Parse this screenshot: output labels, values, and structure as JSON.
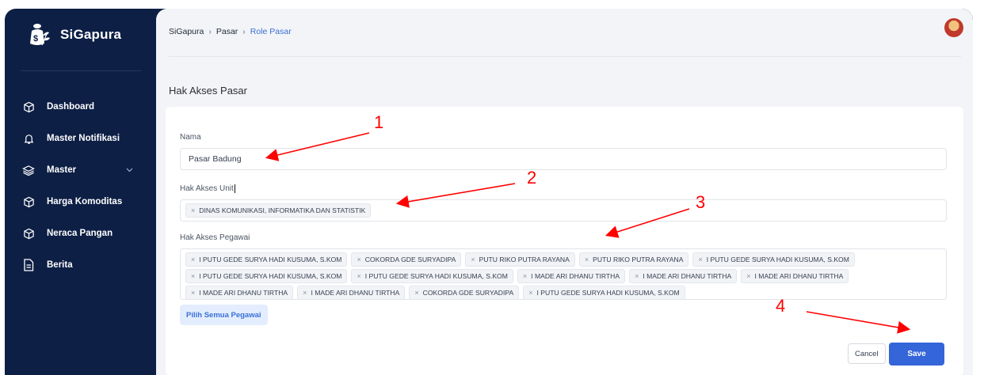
{
  "app": {
    "name": "SiGapura"
  },
  "sidebar": {
    "items": [
      {
        "label": "Dashboard",
        "icon": "cube-icon"
      },
      {
        "label": "Master Notifikasi",
        "icon": "bell-icon"
      },
      {
        "label": "Master",
        "icon": "layers-icon",
        "has_chevron": true
      },
      {
        "label": "Harga Komoditas",
        "icon": "cube-icon"
      },
      {
        "label": "Neraca Pangan",
        "icon": "cube-icon"
      },
      {
        "label": "Berita",
        "icon": "document-icon"
      }
    ]
  },
  "breadcrumb": {
    "items": [
      "SiGapura",
      "Pasar"
    ],
    "current": "Role Pasar",
    "separator": "›"
  },
  "page": {
    "title": "Hak Akses Pasar"
  },
  "form": {
    "nama_label": "Nama",
    "nama_value": "Pasar Badung",
    "unit_label": "Hak Akses Unit",
    "unit_chips": [
      "DINAS KOMUNIKASI, INFORMATIKA DAN STATISTIK"
    ],
    "pegawai_label": "Hak Akses Pegawai",
    "pegawai_chips": [
      "I PUTU GEDE SURYA HADI KUSUMA, S.KOM",
      "COKORDA GDE SURYADIPA",
      "PUTU RIKO PUTRA RAYANA",
      "PUTU RIKO PUTRA RAYANA",
      "I PUTU GEDE SURYA HADI KUSUMA, S.KOM",
      "I PUTU GEDE SURYA HADI KUSUMA, S.KOM",
      "I PUTU GEDE SURYA HADI KUSUMA, S.KOM",
      "I MADE ARI DHANU TIRTHA",
      "I MADE ARI DHANU TIRTHA",
      "I MADE ARI DHANU TIRTHA",
      "I MADE ARI DHANU TIRTHA",
      "I MADE ARI DHANU TIRTHA",
      "COKORDA GDE SURYADIPA",
      "I PUTU GEDE SURYA HADI KUSUMA, S.KOM"
    ],
    "chip_remove_glyph": "×",
    "select_all_label": "Pilih Semua Pegawai",
    "cancel_label": "Cancel",
    "save_label": "Save"
  },
  "annotations": {
    "labels": [
      "1",
      "2",
      "3",
      "4"
    ],
    "color": "#ff0000"
  },
  "colors": {
    "sidebar_bg": "#0d1f45",
    "accent": "#3465d9",
    "content_bg": "#f3f4f7"
  }
}
